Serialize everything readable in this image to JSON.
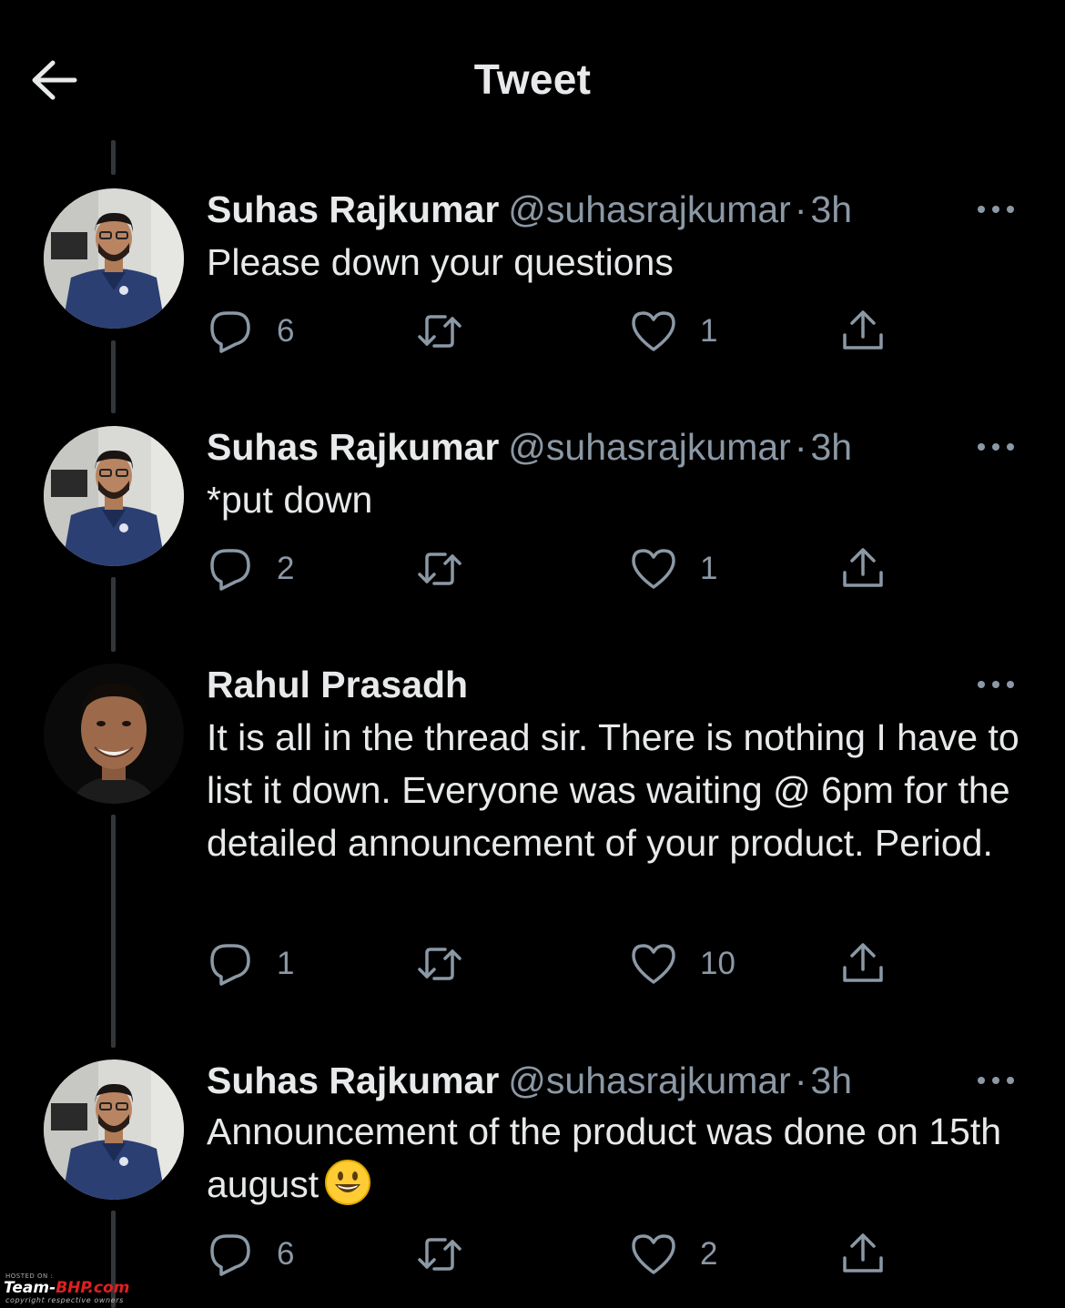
{
  "header": {
    "title": "Tweet",
    "back_icon": "arrow-left-icon"
  },
  "tweets": [
    {
      "display_name": "Suhas Rajkumar",
      "handle": "@suhasrajkumar",
      "separator": "·",
      "time": "3h",
      "text": "Please down your questions",
      "replies": "6",
      "retweets": "",
      "likes": "1"
    },
    {
      "display_name": "Suhas Rajkumar",
      "handle": "@suhasrajkumar",
      "separator": "·",
      "time": "3h",
      "text": "*put down",
      "replies": "2",
      "retweets": "",
      "likes": "1"
    },
    {
      "display_name": "Rahul Prasadh",
      "handle": "",
      "separator": "",
      "time": "",
      "text": "It is all in the thread sir. There is nothing I have to list it down. Everyone was waiting @ 6pm for the detailed announcement of your product. Period.",
      "replies": "1",
      "retweets": "",
      "likes": "10"
    },
    {
      "display_name": "Suhas Rajkumar",
      "handle": "@suhasrajkumar",
      "separator": "·",
      "time": "3h",
      "text": "Announcement of the product was done on 15th august",
      "emoji": "smiling-face-emoji",
      "replies": "6",
      "retweets": "",
      "likes": "2"
    }
  ],
  "icons": {
    "reply": "reply-bubble-icon",
    "retweet": "retweet-icon",
    "like": "heart-icon",
    "share": "share-upload-icon",
    "more": "more-options-icon"
  },
  "colors": {
    "background": "#000000",
    "text_primary": "#e7e9ea",
    "text_secondary": "#8b98a5",
    "thread_line": "#333639"
  },
  "watermark": {
    "hosted": "HOSTED ON :",
    "brand_prefix": "Team-",
    "brand_accent": "BHP",
    "brand_suffix": ".com",
    "copyright": "copyright respective owners"
  }
}
